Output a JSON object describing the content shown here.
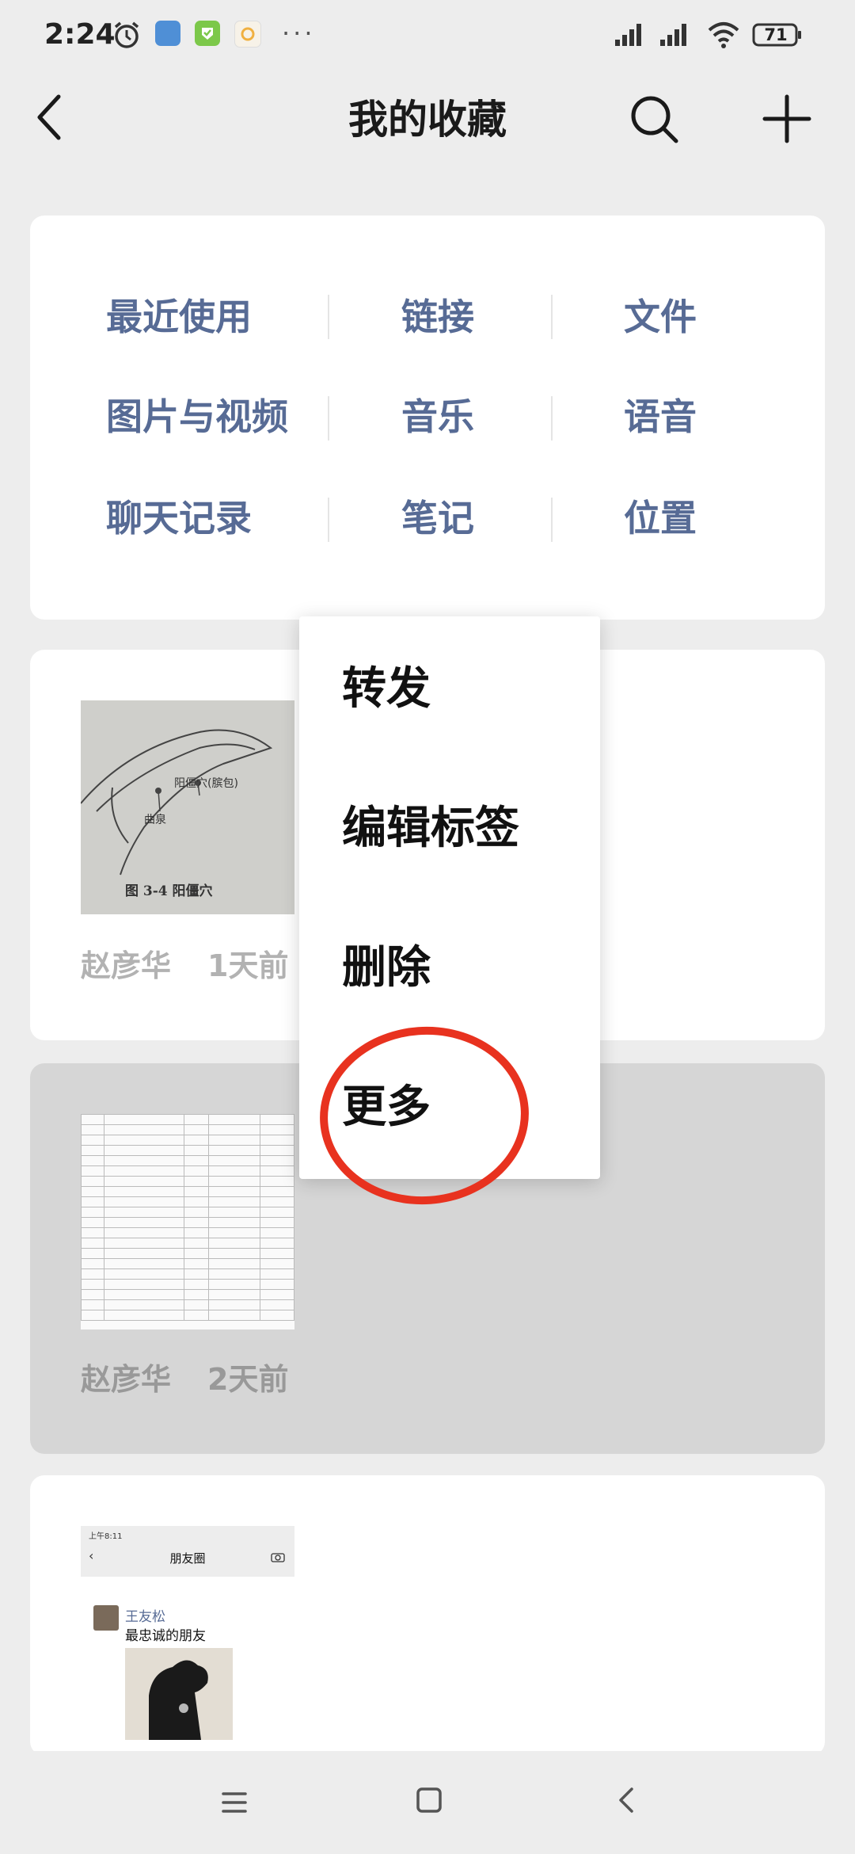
{
  "status_bar": {
    "time": "2:24",
    "dots": "···",
    "battery": "71"
  },
  "header": {
    "title": "我的收藏"
  },
  "categories": {
    "row1": [
      "最近使用",
      "链接",
      "文件"
    ],
    "row2": [
      "图片与视频",
      "音乐",
      "语音"
    ],
    "row3": [
      "聊天记录",
      "笔记",
      "位置"
    ]
  },
  "items": [
    {
      "author": "赵彦华",
      "time": "1天前",
      "thumb_caption": "图 3-4   阳僵穴",
      "thumb_label1": "曲泉",
      "thumb_label2": "阳僵穴(膑包)"
    },
    {
      "author": "赵彦华",
      "time": "2天前"
    },
    {
      "moments_status": "上午8:11",
      "moments_title": "朋友圈",
      "moments_author": "王友松",
      "moments_text": "最忠诚的朋友"
    }
  ],
  "context_menu": {
    "items": [
      "转发",
      "编辑标签",
      "删除",
      "更多"
    ],
    "highlight_color": "#e8321f"
  },
  "colors": {
    "link": "#576b95",
    "background": "#ededed"
  }
}
